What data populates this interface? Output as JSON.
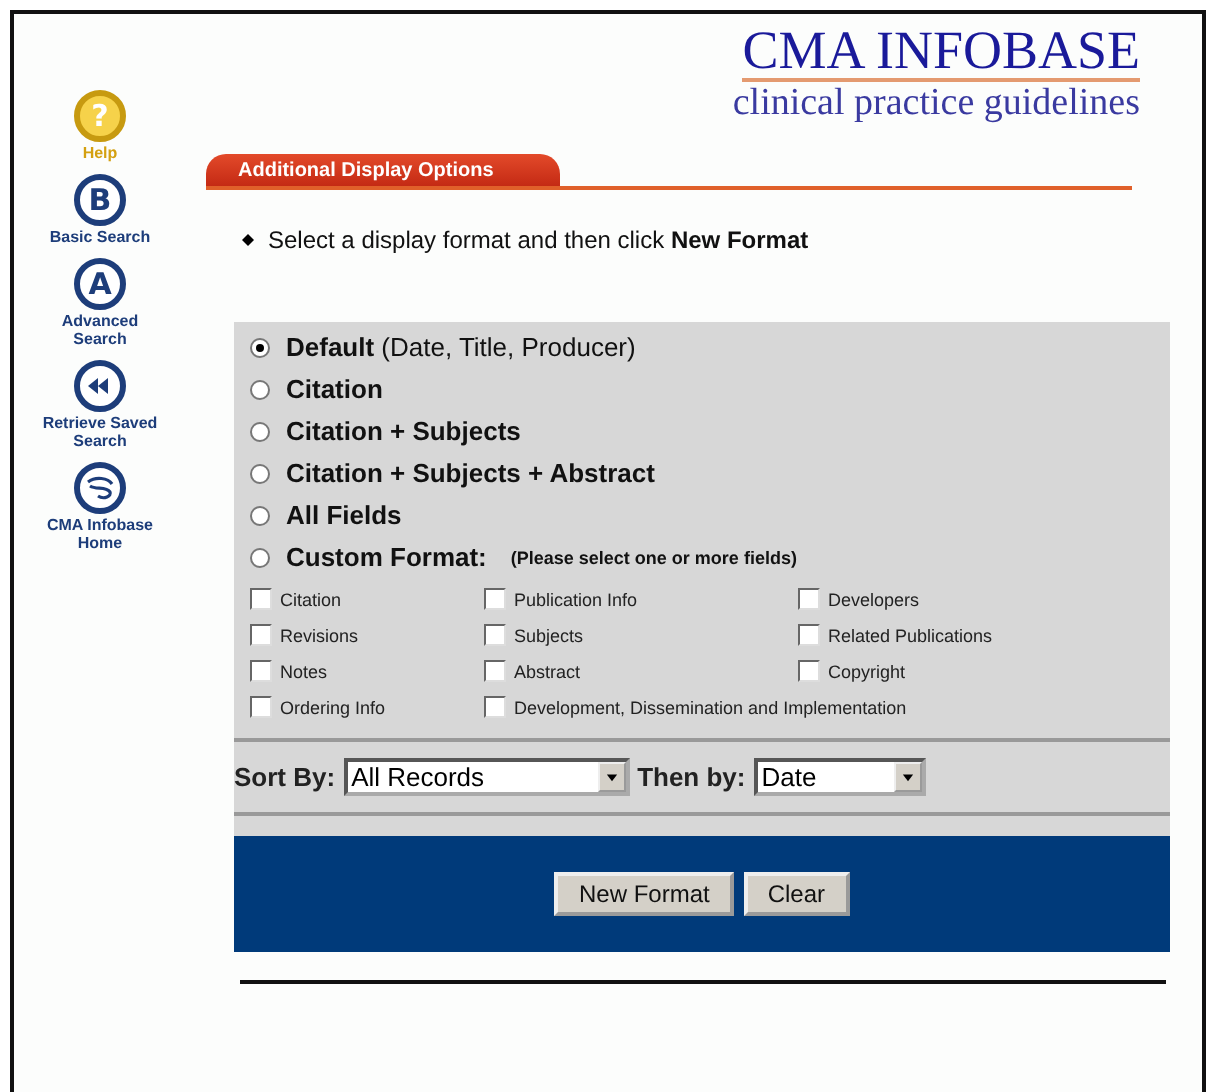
{
  "header": {
    "title": "CMA INFOBASE",
    "subtitle": "clinical practice guidelines"
  },
  "nav": [
    {
      "kind": "help",
      "glyph": "?",
      "label": "Help"
    },
    {
      "kind": "letter",
      "glyph": "B",
      "label": "Basic Search"
    },
    {
      "kind": "letter",
      "glyph": "A",
      "label": "Advanced Search"
    },
    {
      "kind": "rewind",
      "label": "Retrieve Saved Search"
    },
    {
      "kind": "home",
      "label": "CMA Infobase Home"
    }
  ],
  "tab": {
    "label": "Additional Display Options"
  },
  "instruction": "Select a display format and then click **New Format**",
  "formats": [
    {
      "label": "**Default** (Date, Title, Producer)",
      "selected": true
    },
    {
      "label": "**Citation**",
      "selected": false
    },
    {
      "label": "**Citation + Subjects**",
      "selected": false
    },
    {
      "label": "**Citation + Subjects + Abstract**",
      "selected": false
    },
    {
      "label": "**All Fields**",
      "selected": false
    },
    {
      "label": "**Custom Format:**",
      "note": "(Please select one or more fields)",
      "selected": false
    }
  ],
  "fields": [
    {
      "label": "Citation",
      "checked": false
    },
    {
      "label": "Publication Info",
      "checked": false
    },
    {
      "label": "Developers",
      "checked": false
    },
    {
      "label": "Revisions",
      "checked": false
    },
    {
      "label": "Subjects",
      "checked": false
    },
    {
      "label": "Related Publications",
      "checked": false
    },
    {
      "label": "Notes",
      "checked": false
    },
    {
      "label": "Abstract",
      "checked": false
    },
    {
      "label": "Copyright",
      "checked": false
    },
    {
      "label": "Ordering Info",
      "checked": false
    },
    {
      "label": "Development, Dissemination and Implementation",
      "checked": false
    }
  ],
  "sort": {
    "label": "Sort By:",
    "value": "All Records"
  },
  "then_by": {
    "label": "Then by:",
    "value": "Date"
  },
  "buttons": [
    "New Format",
    "Clear"
  ]
}
